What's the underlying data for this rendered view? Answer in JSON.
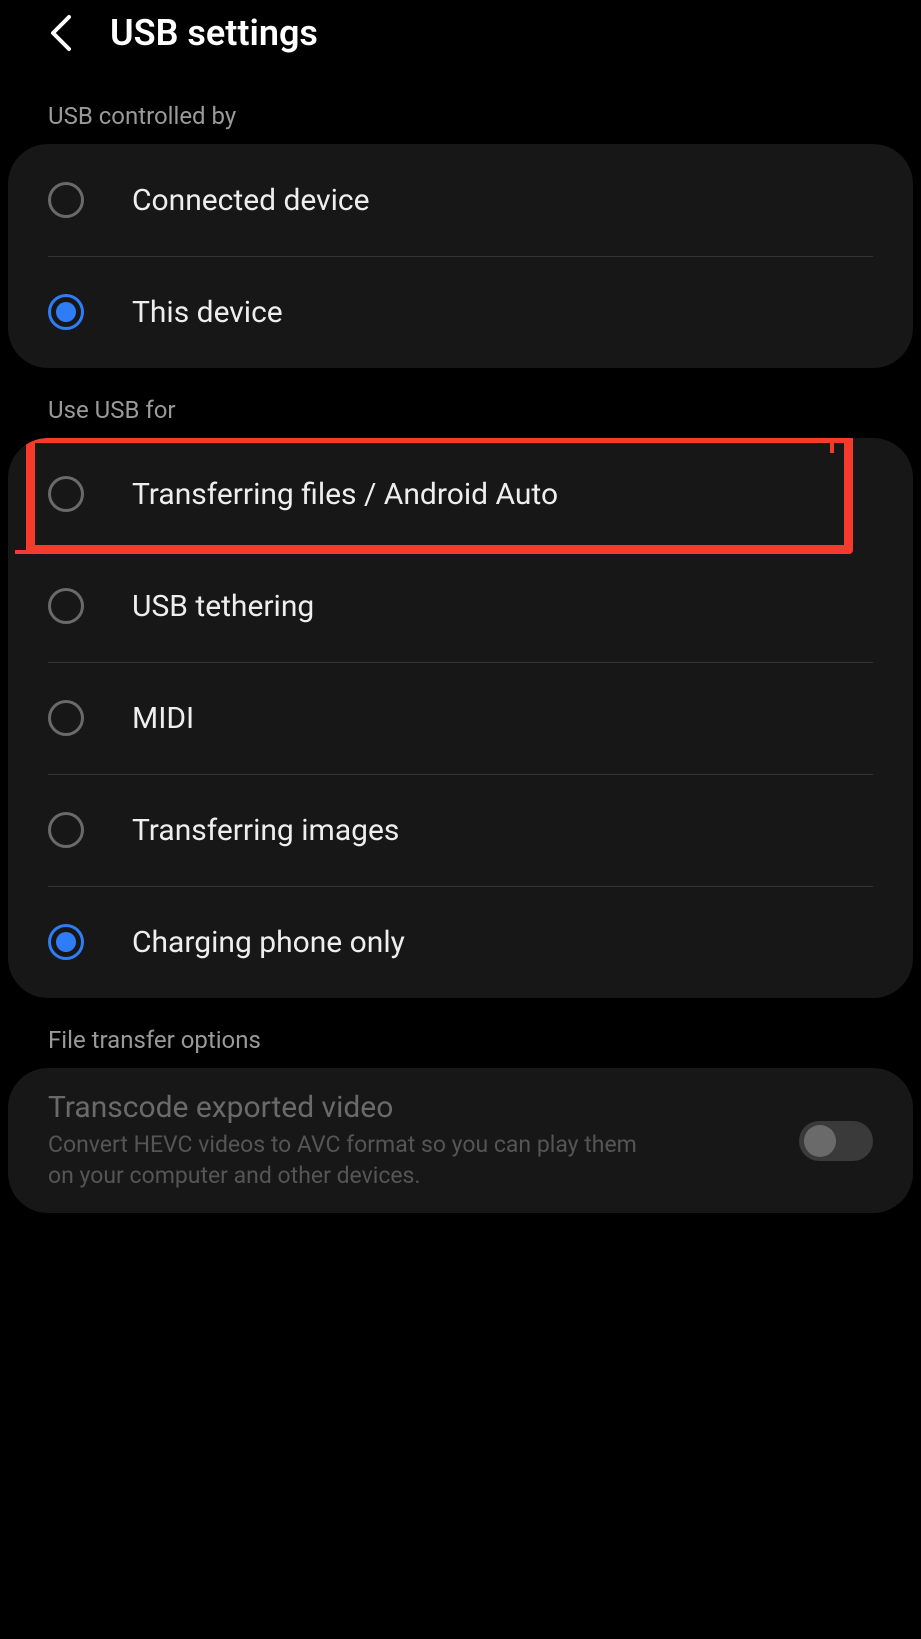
{
  "header": {
    "title": "USB settings"
  },
  "sections": {
    "controlled_by": {
      "label": "USB controlled by",
      "options": [
        {
          "label": "Connected device",
          "selected": false
        },
        {
          "label": "This device",
          "selected": true
        }
      ]
    },
    "use_for": {
      "label": "Use USB for",
      "options": [
        {
          "label": "Transferring files / Android Auto",
          "selected": false,
          "highlighted": true
        },
        {
          "label": "USB tethering",
          "selected": false
        },
        {
          "label": "MIDI",
          "selected": false
        },
        {
          "label": "Transferring images",
          "selected": false
        },
        {
          "label": "Charging phone only",
          "selected": true
        }
      ]
    },
    "file_transfer": {
      "label": "File transfer options",
      "toggle": {
        "title": "Transcode exported video",
        "description": "Convert HEVC videos to AVC format so you can play them on your computer and other devices.",
        "on": false
      }
    }
  },
  "colors": {
    "accent": "#2f7df6",
    "highlight": "#f83a2d"
  }
}
